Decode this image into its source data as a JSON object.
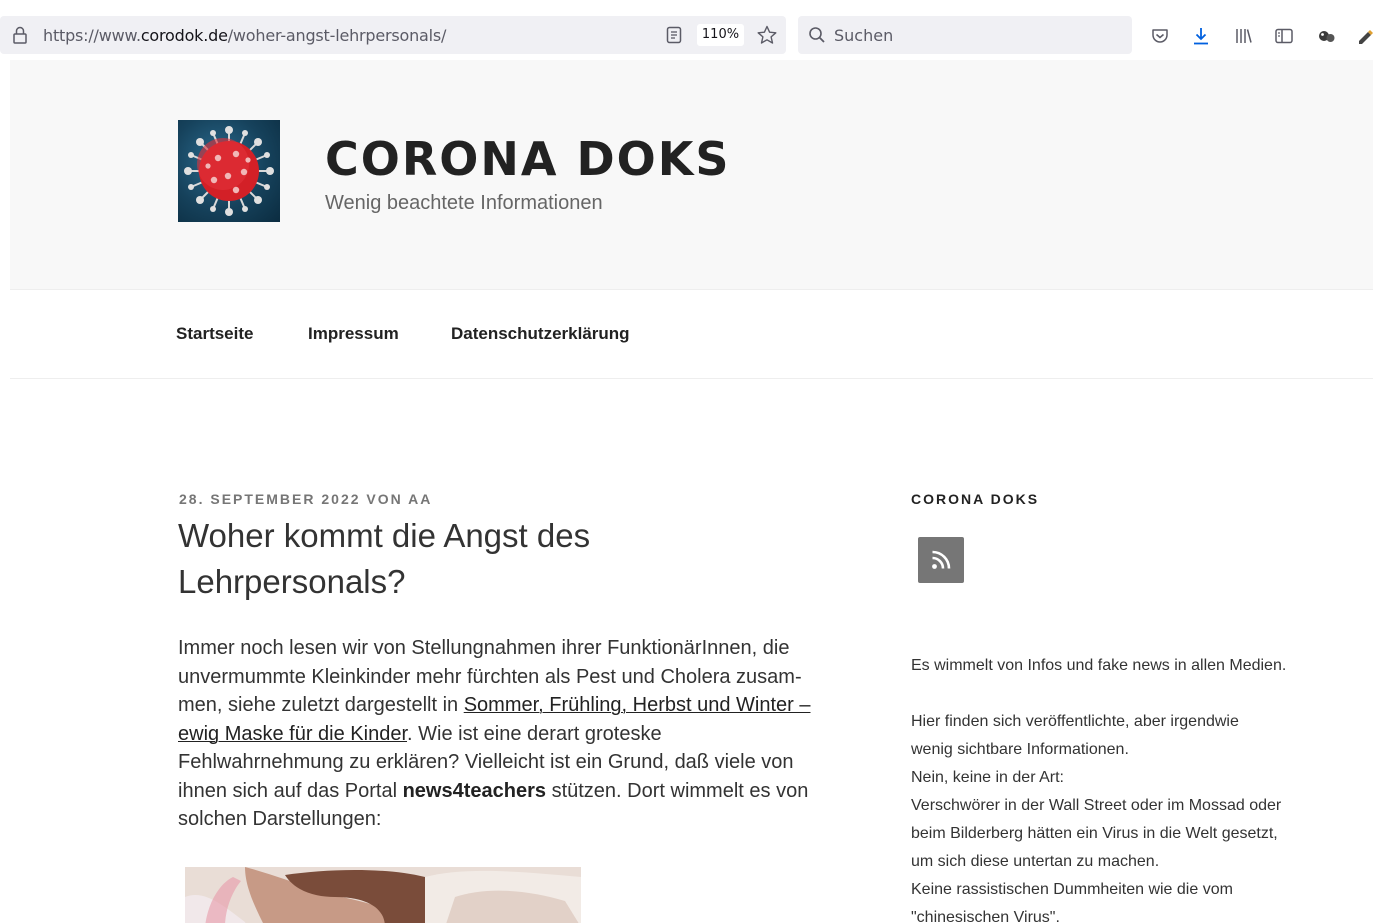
{
  "browser": {
    "url_prefix": "https://www.",
    "url_domain": "corodok.de",
    "url_path": "/woher-angst-lehrpersonals/",
    "zoom": "110%",
    "search_placeholder": "Suchen"
  },
  "header": {
    "title": "CORONA DOKS",
    "description": "Wenig beachtete Informationen"
  },
  "nav": {
    "items": [
      "Startseite",
      "Impressum",
      "Datenschutzerklärung"
    ]
  },
  "article": {
    "meta": "28. SEPTEMBER 2022 VON AA",
    "title_line1": "Woher kommt die Angst des",
    "title_line2": "Lehrpersonals?",
    "p_line1": "Immer noch lesen wir von Stellungnahmen ihrer FunktionärInnen, die",
    "p_line2": "unvermummte Kleinkinder mehr fürchten als Pest und Cholera zusam-",
    "p_line3_start": "men, siehe zuletzt dargestellt in ",
    "p_link_part1": "Sommer, Frühling, Herbst und Winter –",
    "p_link_part2": "ewig Maske für die Kinder",
    "p_line4_end": ". Wie ist eine derart groteske",
    "p_line5": "Fehlwahrnehmung zu erklären? Vielleicht ist ein Grund, daß viele von",
    "p_line6_start": "ihnen sich auf das Portal ",
    "p_strong": "news4teachers",
    "p_line6_end": " stützen. Dort wimmelt es von",
    "p_line7": "solchen Darstellungen:"
  },
  "sidebar": {
    "widget_title": "CORONA DOKS",
    "text_lines": [
      "Es wimmelt von Infos und fake news in allen Medien.",
      "",
      "Hier finden sich veröffentlichte, aber irgendwie",
      "wenig sichtbare Informationen.",
      "Nein, keine in der Art:",
      "Verschwörer in der Wall Street oder im Mossad oder",
      "beim Bilderberg hätten ein Virus in die Welt gesetzt,",
      "um sich diese untertan zu machen.",
      "Keine rassistischen Dummheiten wie die vom",
      "\"chinesischen Virus\"."
    ]
  },
  "colors": {
    "accent_blue": "#0060df",
    "meta_gray": "#767676",
    "header_bg": "#f8f8f8"
  }
}
